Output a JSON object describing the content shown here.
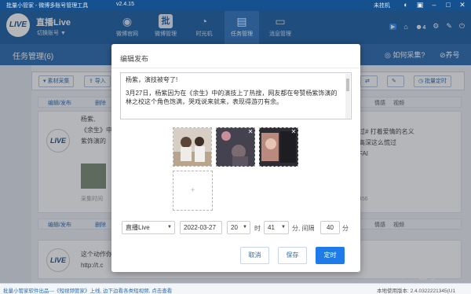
{
  "titlebar": {
    "app_title": "批量小管家 - 微博多账号管理工具",
    "version": "v2.4.15",
    "status": "未挂机"
  },
  "nav": {
    "brand": "直播Live",
    "account": "切换账号 ▼",
    "logo_text": "LIVE",
    "items": [
      {
        "label": "微博官网",
        "icon": "weibo-icon"
      },
      {
        "label": "微博管理",
        "icon": "batch-icon"
      },
      {
        "label": "时光机",
        "icon": "clock-icon"
      },
      {
        "label": "任务管理",
        "icon": "task-icon"
      },
      {
        "label": "消息管理",
        "icon": "message-icon"
      }
    ],
    "right_count": "4"
  },
  "pagebar": {
    "title": "任务管理(6)",
    "help": "如何采集?",
    "vip": "养号"
  },
  "toolbar": {
    "collect": "素材采集",
    "import": "导入",
    "batch_timing": "批量定时"
  },
  "background": {
    "edit_publish": "编辑/发布",
    "delete": "删除",
    "emotion": "情感",
    "video": "视频",
    "text_1": "杨紫,",
    "text_2": "《余生》中",
    "text_3": "紫饰演的",
    "hashtag_1": "过# 打着爱情的名义",
    "hashtag_2": "高深这么慌过",
    "hashtag_3": "FAI",
    "collect_time": "采集时间",
    "text_4": "这个动作你",
    "text_5": "http://t.c",
    "right_num": "456"
  },
  "footer": {
    "text": "批量小管家软件出品---《短视频管家》上线, 边下边看各类短视频, 点击查看",
    "version": "本地使用版本: 2.4.0322221345(U1"
  },
  "watermark": "知乎 @yooi",
  "modal": {
    "title": "编辑发布",
    "paragraph_1": "杨紫，演技被夸了!",
    "paragraph_2": "3月27日，杨紫因为在《余生》中的演技上了热搜，网友都在夸赞杨紫饰演的林之校这个角色饱满，哭戏说来就来，表现得游刃有余。",
    "add_label": "+",
    "account_select": "直播Live",
    "date": "2022-03-27",
    "hour": "20",
    "hour_label": "时",
    "minute": "41",
    "minute_label": "分, 间隔",
    "interval": "40",
    "interval_label": "分",
    "cancel": "取消",
    "save": "保存",
    "schedule": "定时"
  }
}
